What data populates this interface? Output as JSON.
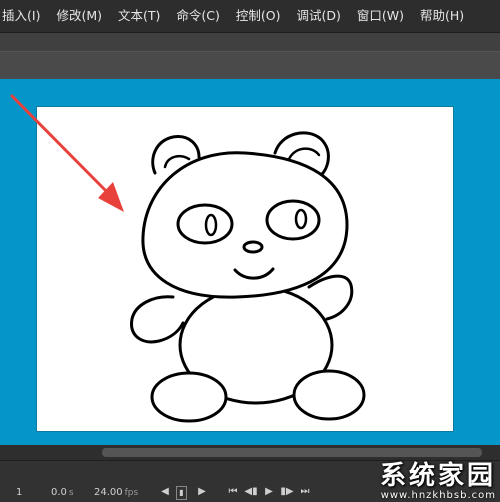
{
  "menu": {
    "items": [
      {
        "label": "插入(I)"
      },
      {
        "label": "修改(M)"
      },
      {
        "label": "文本(T)"
      },
      {
        "label": "命令(C)"
      },
      {
        "label": "控制(O)"
      },
      {
        "label": "调试(D)"
      },
      {
        "label": "窗口(W)"
      },
      {
        "label": "帮助(H)"
      }
    ]
  },
  "stage": {
    "background": "#ffffff",
    "pasteboard_color": "#0596c9",
    "content": "panda-drawing"
  },
  "annotation": {
    "arrow_color": "#e8413c"
  },
  "timeline": {
    "frame": "1",
    "time": "0.0",
    "time_unit": "s",
    "fps": "24.00",
    "fps_unit": "fps"
  },
  "watermark": {
    "title": "系统家园",
    "url": "www.hnzkhbsb.com"
  }
}
